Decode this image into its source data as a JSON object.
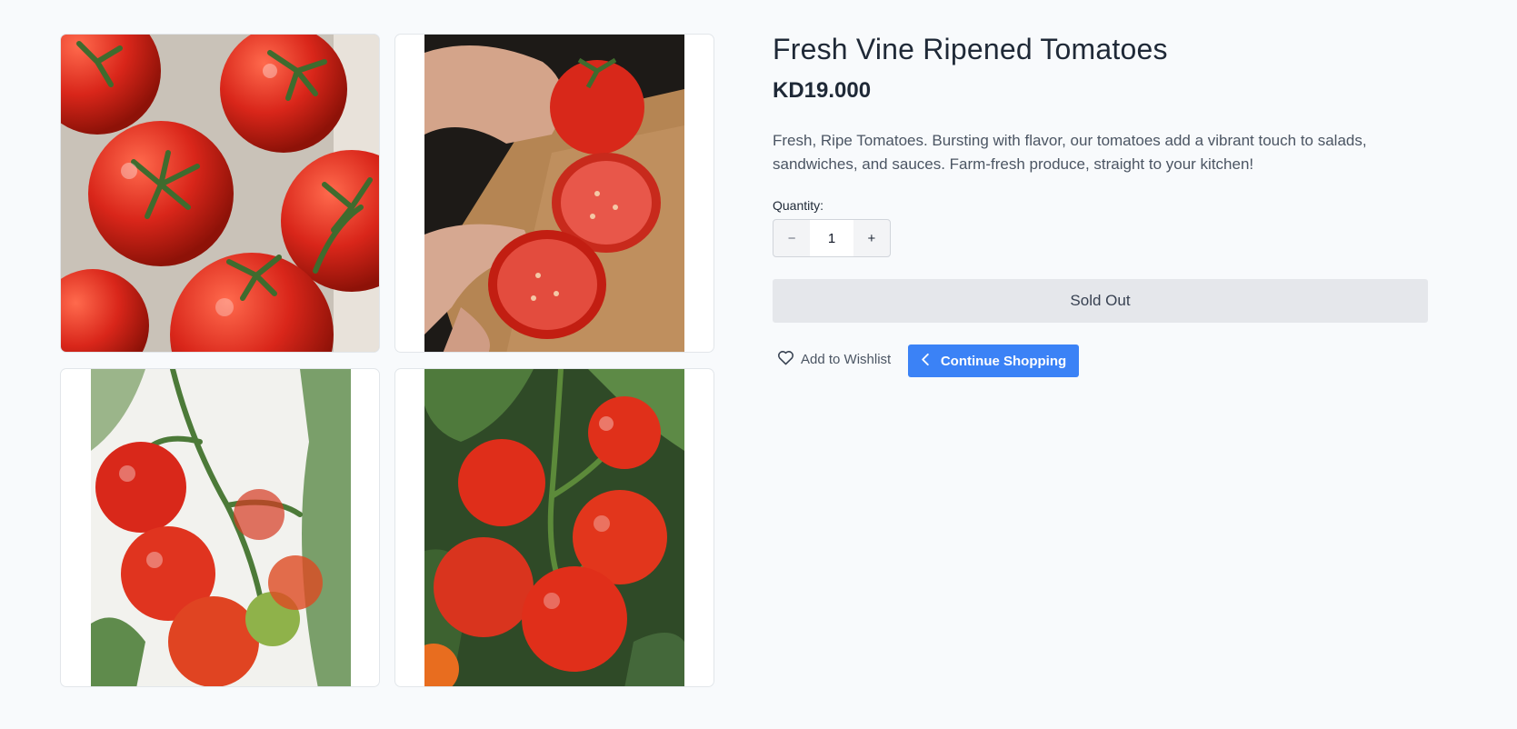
{
  "product": {
    "title": "Fresh Vine Ripened Tomatoes",
    "price": "KD19.000",
    "description": "Fresh, Ripe Tomatoes. Bursting with flavor, our tomatoes add a vibrant touch to salads, sandwiches, and sauces. Farm-fresh produce, straight to your kitchen!"
  },
  "quantity": {
    "label": "Quantity:",
    "value": "1",
    "decrement": "−",
    "increment": "+"
  },
  "actions": {
    "sold_out_label": "Sold Out",
    "wishlist_label": "Add to Wishlist",
    "continue_label": "Continue Shopping"
  },
  "icons": {
    "wishlist": "heart-icon",
    "continue": "chevron-left-icon"
  },
  "colors": {
    "accent": "#3b82f6",
    "tomato_red": "#d92b1a",
    "stem_green": "#3f6b2e"
  }
}
